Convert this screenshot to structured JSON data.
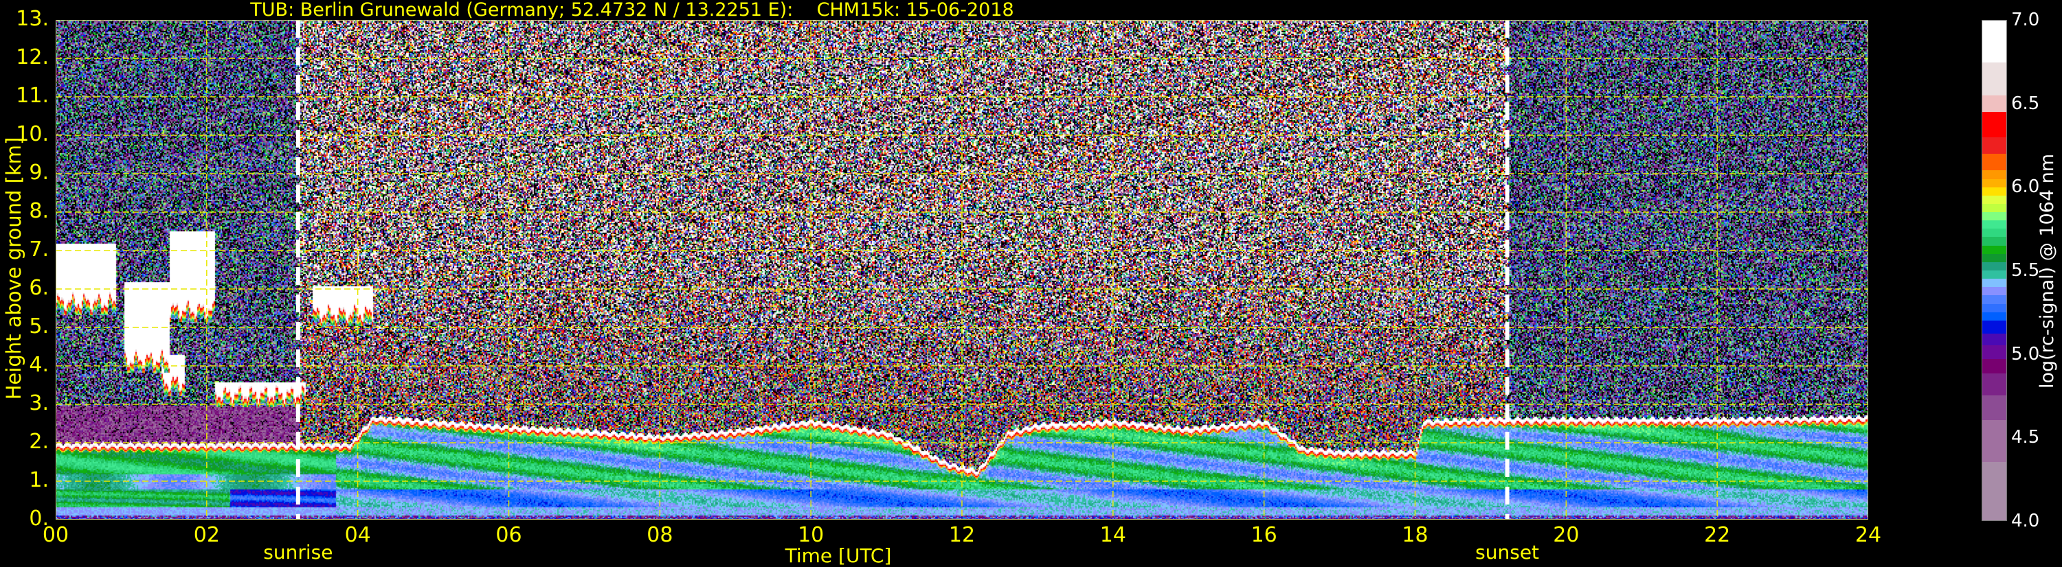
{
  "title": "TUB: Berlin Grunewald (Germany; 52.4732 N / 13.2251 E):    CHM15k: 15-06-2018",
  "chart_data": {
    "type": "heatmap",
    "title": "TUB: Berlin Grunewald (Germany; 52.4732 N / 13.2251 E):    CHM15k: 15-06-2018",
    "xlabel": "Time [UTC]",
    "ylabel": "Height above ground [km]",
    "xlim": [
      0,
      24
    ],
    "ylim": [
      0,
      13
    ],
    "grid": true,
    "xticks": [
      0,
      2,
      4,
      6,
      8,
      10,
      12,
      14,
      16,
      18,
      20,
      22,
      24
    ],
    "xtick_labels": [
      "00",
      "02",
      "04",
      "06",
      "08",
      "10",
      "12",
      "14",
      "16",
      "18",
      "20",
      "22",
      "24"
    ],
    "yticks": [
      0,
      1,
      2,
      3,
      4,
      5,
      6,
      7,
      8,
      9,
      10,
      11,
      12,
      13
    ],
    "ytick_labels": [
      "0.",
      "1.",
      "2.",
      "3.",
      "4.",
      "5.",
      "6.",
      "7.",
      "8.",
      "9.",
      "10.",
      "11.",
      "12.",
      "13."
    ],
    "annotations": [
      {
        "label": "sunrise",
        "time_h": 3.21
      },
      {
        "label": "sunset",
        "time_h": 19.22
      }
    ],
    "colorbar": {
      "label": "log(rc-signal) @ 1064 nm",
      "range": [
        4.0,
        7.0
      ],
      "ticks": [
        4.0,
        4.5,
        5.0,
        5.5,
        6.0,
        6.5,
        7.0
      ],
      "tick_labels": [
        "4.0",
        "4.5",
        "5.0",
        "5.5",
        "6.0",
        "6.5",
        "7.0"
      ],
      "colors": [
        [
          4.0,
          "#a88ca8"
        ],
        [
          4.35,
          "#a070a0"
        ],
        [
          4.6,
          "#8c4c94"
        ],
        [
          4.75,
          "#7c2488"
        ],
        [
          4.88,
          "#780070"
        ],
        [
          4.97,
          "#6a0a9a"
        ],
        [
          5.05,
          "#4a0ab4"
        ],
        [
          5.12,
          "#0010e0"
        ],
        [
          5.2,
          "#0060ff"
        ],
        [
          5.25,
          "#3070ff"
        ],
        [
          5.3,
          "#5080ff"
        ],
        [
          5.35,
          "#8890ff"
        ],
        [
          5.4,
          "#80c0ff"
        ],
        [
          5.45,
          "#30c0a0"
        ],
        [
          5.5,
          "#20a080"
        ],
        [
          5.55,
          "#109830"
        ],
        [
          5.6,
          "#10b010"
        ],
        [
          5.65,
          "#20c060"
        ],
        [
          5.7,
          "#30d880"
        ],
        [
          5.75,
          "#40e890"
        ],
        [
          5.8,
          "#80ff80"
        ],
        [
          5.85,
          "#c0ff40"
        ],
        [
          5.9,
          "#e0ff40"
        ],
        [
          5.95,
          "#ffe000"
        ],
        [
          6.0,
          "#ffb000"
        ],
        [
          6.05,
          "#ff9800"
        ],
        [
          6.1,
          "#ff6000"
        ],
        [
          6.2,
          "#ee2020"
        ],
        [
          6.3,
          "#ff0000"
        ],
        [
          6.45,
          "#f0c0c0"
        ],
        [
          6.55,
          "#ece0e0"
        ],
        [
          6.75,
          "#ffffff"
        ]
      ]
    },
    "boundary_layer_top_km": {
      "time_h": [
        0,
        3,
        3.9,
        4.2,
        6,
        7,
        8,
        9,
        10,
        11,
        11.8,
        12.2,
        12.6,
        13,
        14,
        15,
        16,
        16.5,
        17,
        18,
        18.1,
        19,
        22,
        24
      ],
      "height_km": [
        2.0,
        2.0,
        2.0,
        2.7,
        2.45,
        2.35,
        2.2,
        2.35,
        2.6,
        2.3,
        1.5,
        1.3,
        2.3,
        2.5,
        2.6,
        2.4,
        2.6,
        1.9,
        1.8,
        1.8,
        2.6,
        2.65,
        2.65,
        2.7
      ]
    },
    "cloud_layers": [
      {
        "time_h": [
          0.0,
          0.8
        ],
        "base_km": 5.7,
        "top_km": 7.2
      },
      {
        "time_h": [
          0.9,
          1.5
        ],
        "base_km": 4.2,
        "top_km": 6.2
      },
      {
        "time_h": [
          1.5,
          2.1
        ],
        "base_km": 5.5,
        "top_km": 7.5
      },
      {
        "time_h": [
          1.4,
          1.7
        ],
        "base_km": 3.6,
        "top_km": 4.3
      },
      {
        "time_h": [
          2.1,
          3.3
        ],
        "base_km": 3.3,
        "top_km": 3.6
      },
      {
        "time_h": [
          3.4,
          4.2
        ],
        "base_km": 5.4,
        "top_km": 6.1
      }
    ]
  }
}
